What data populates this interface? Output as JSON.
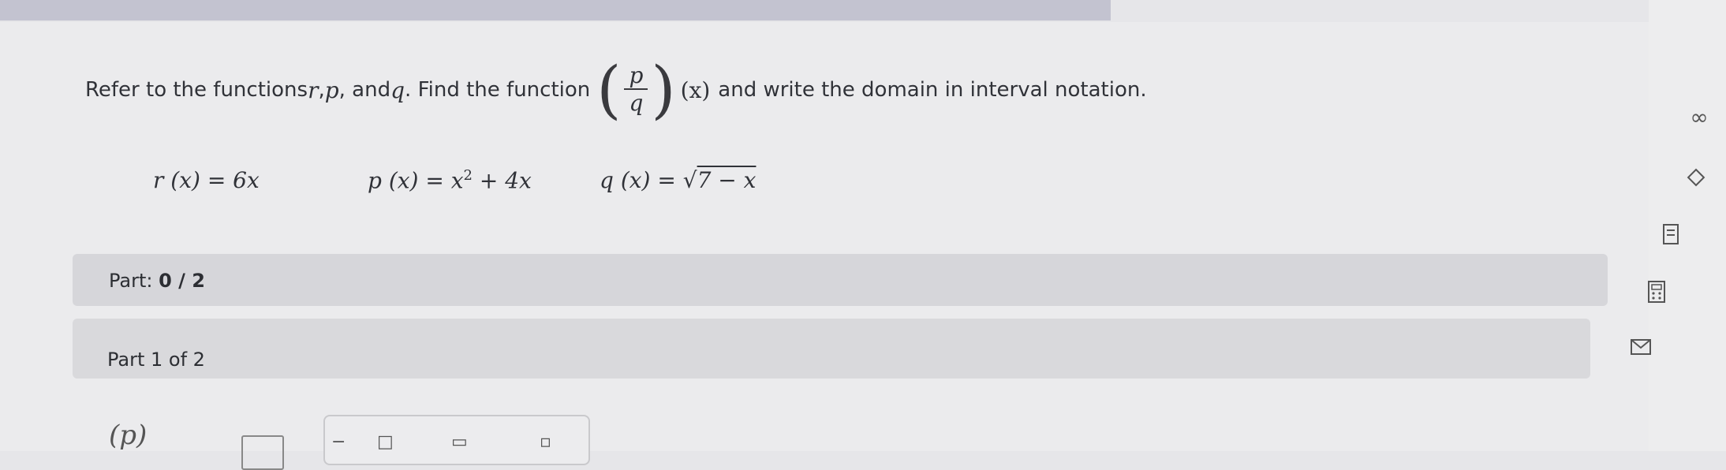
{
  "question": {
    "prefix": "Refer to the functions ",
    "var_r": "r",
    "sep1": ", ",
    "var_p": "p",
    "sep2": ", and ",
    "var_q": "q",
    "mid": ". Find the function ",
    "frac_num": "p",
    "frac_den": "q",
    "arg": "(x)",
    "suffix": " and write the domain in interval notation."
  },
  "functions": {
    "r": "r (x) = 6x",
    "p_lhs": "p (x) = x",
    "p_exp": "2",
    "p_rest": " + 4x",
    "q_lhs": "q (x) = ",
    "q_radical": "√",
    "q_radicand": "7 − x"
  },
  "part_progress": {
    "label": "Part: ",
    "value": "0 / 2"
  },
  "part_header": {
    "label": "Part 1 of 2"
  },
  "answer": {
    "expr": "(p)"
  },
  "sidebar": {
    "icons": [
      "infinity-icon",
      "diamond-icon",
      "notepad-icon",
      "calculator-icon",
      "mail-icon"
    ],
    "infinity_glyph": "∞"
  }
}
